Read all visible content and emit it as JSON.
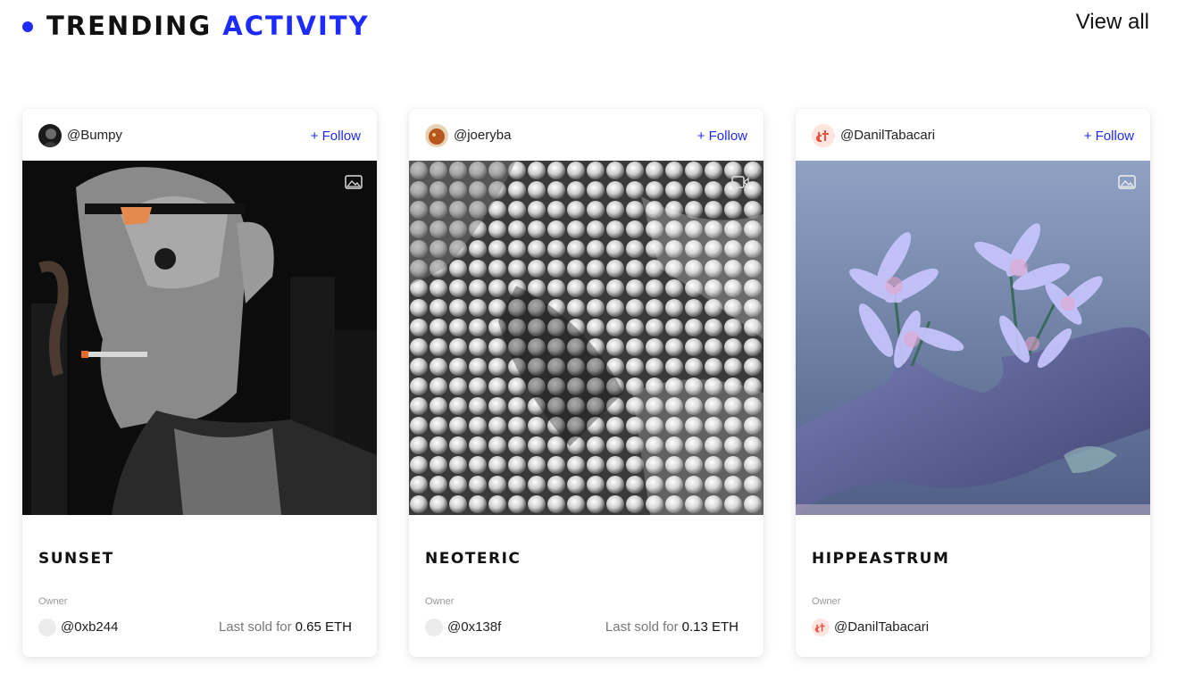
{
  "header": {
    "title_main": "TRENDING",
    "title_accent": "ACTIVITY",
    "view_all": "View all"
  },
  "colors": {
    "accent": "#1d2bff"
  },
  "cards": [
    {
      "creator": "@Bumpy",
      "follow": "+ Follow",
      "media_type": "image-icon",
      "title": "SUNSET",
      "owner_label": "Owner",
      "owner": "@0xb244",
      "last_sold_label": "Last sold for",
      "price": "0.65 ETH"
    },
    {
      "creator": "@joeryba",
      "follow": "+ Follow",
      "media_type": "video-icon",
      "title": "NEOTERIC",
      "owner_label": "Owner",
      "owner": "@0x138f",
      "last_sold_label": "Last sold for",
      "price": "0.13 ETH"
    },
    {
      "creator": "@DanilTabacari",
      "follow": "+ Follow",
      "media_type": "image-icon",
      "title": "HIPPEASTRUM",
      "owner_label": "Owner",
      "owner": "@DanilTabacari"
    }
  ]
}
